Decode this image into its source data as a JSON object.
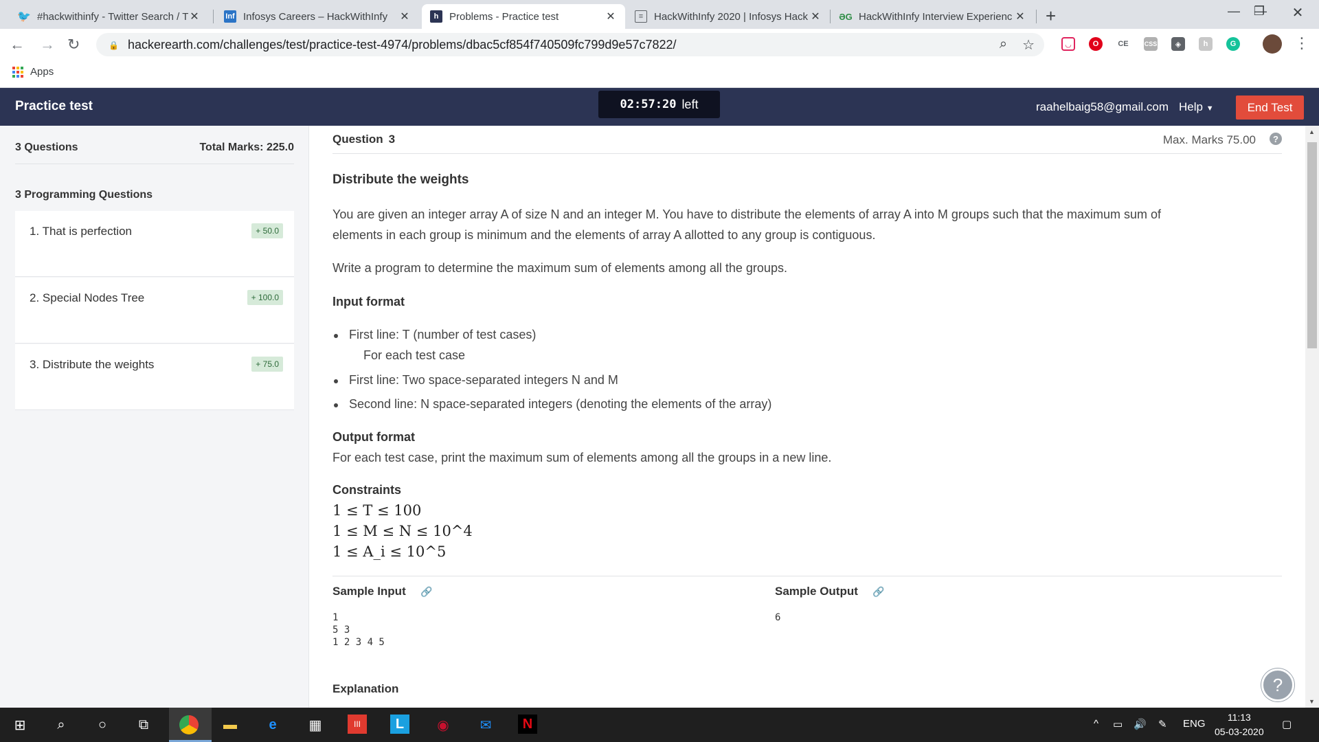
{
  "browser": {
    "tabs": [
      {
        "title": "#hackwithinfy - Twitter Search / T",
        "icon": "twitter-icon",
        "active": false
      },
      {
        "title": "Infosys Careers – HackWithInfy",
        "icon": "infosys-icon",
        "active": false
      },
      {
        "title": "Problems - Practice test",
        "icon": "hackerearth-icon",
        "active": true
      },
      {
        "title": "HackWithInfy 2020 | Infosys Hack",
        "icon": "page-icon",
        "active": false
      },
      {
        "title": "HackWithInfy Interview Experienc",
        "icon": "gfg-icon",
        "active": false
      }
    ],
    "url": "hackerearth.com/challenges/test/practice-test-4974/problems/dbac5cf854f740509fc799d9e57c7822/",
    "bookmarks_apps_label": "Apps"
  },
  "header": {
    "title": "Practice test",
    "timer_value": "02:57:20",
    "timer_suffix": "left",
    "user_email": "raahelbaig58@gmail.com",
    "help_label": "Help",
    "end_test_label": "End Test"
  },
  "sidebar": {
    "questions_count": "3 Questions",
    "total_marks": "Total Marks: 225.0",
    "section_title": "3 Programming Questions",
    "items": [
      {
        "label": "1. That is perfection",
        "marks": "+ 50.0"
      },
      {
        "label": "2. Special Nodes Tree",
        "marks": "+ 100.0"
      },
      {
        "label": "3. Distribute the weights",
        "marks": "+ 75.0"
      }
    ]
  },
  "question": {
    "label": "Question",
    "number": "3",
    "max_marks": "Max. Marks 75.00",
    "title": "Distribute the weights",
    "statement_1": "You are given an integer array A of size N and an integer M. You have to distribute the elements of array A into M groups such that the maximum sum of",
    "statement_2": "elements in each group is minimum and the elements of array A allotted to any group is contiguous.",
    "statement_3": "Write a program to determine the maximum sum of elements among all the groups.",
    "input_format_title": "Input format",
    "input_bullets": [
      "First line: T (number of test cases)",
      "First line: Two space-separated integers N and M",
      "Second line: N space-separated integers (denoting the elements of the array)"
    ],
    "input_subline": "For each test case",
    "output_format_title": "Output format",
    "output_format_text": "For each test case, print the maximum sum of elements among all the groups in a new line.",
    "constraints_title": "Constraints",
    "constraints": [
      "1 ≤ T ≤ 100",
      "1 ≤ M ≤ N ≤ 10^4",
      "1 ≤ A_i ≤ 10^5"
    ],
    "sample_input_label": "Sample Input",
    "sample_output_label": "Sample Output",
    "sample_input": "1\n5 3\n1 2 3 4 5",
    "sample_output": "6",
    "explanation_label": "Explanation"
  },
  "taskbar": {
    "lang": "ENG",
    "time": "11:13",
    "date": "05-03-2020"
  },
  "colors": {
    "header_bg": "#2c3454",
    "end_test": "#e24c3b",
    "badge_bg": "#d6ead9",
    "link": "#2a7ad6"
  }
}
